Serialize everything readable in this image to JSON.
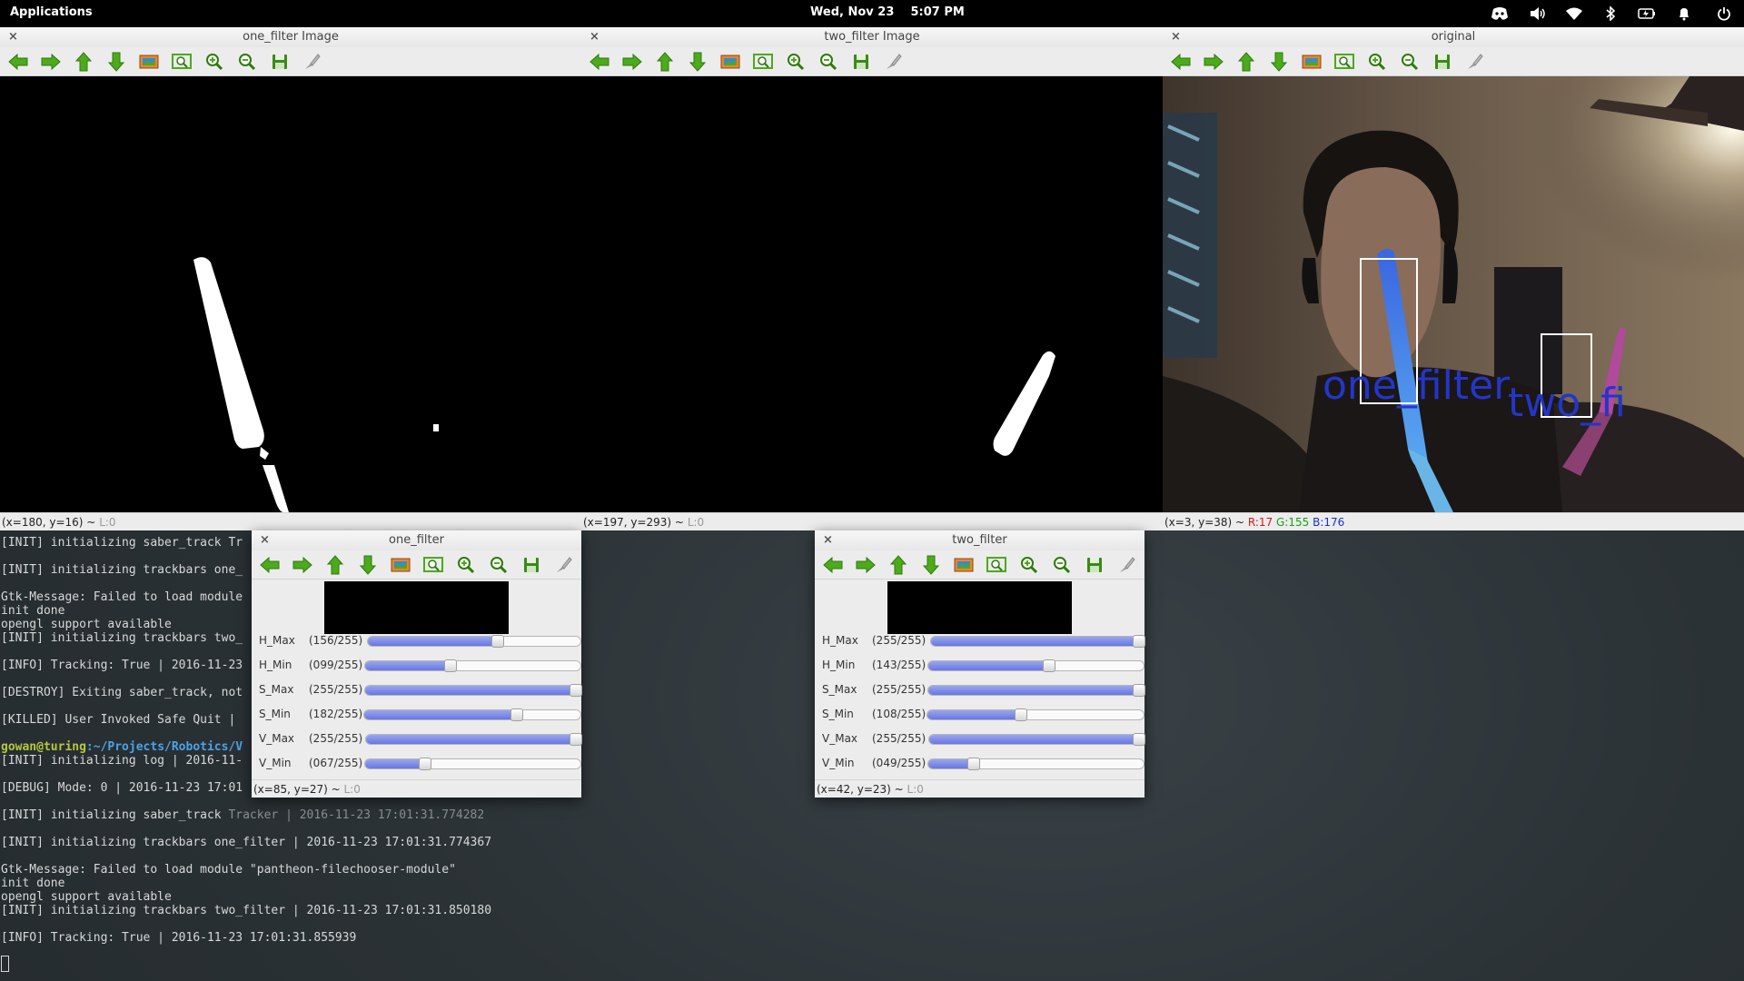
{
  "panel": {
    "apps": "Applications",
    "clock": "Wed, Nov 23    5:07 PM",
    "tray_icons": [
      "discord-icon",
      "volume-icon",
      "wifi-icon",
      "bluetooth-icon",
      "battery-icon",
      "notification-bell-icon",
      "power-icon"
    ]
  },
  "toolbar_icons": [
    "arrow-left-icon",
    "arrow-right-icon",
    "arrow-up-icon",
    "arrow-down-icon",
    "image-icon",
    "zoom-fit-icon",
    "zoom-in-icon",
    "zoom-out-icon",
    "save-icon",
    "properties-icon"
  ],
  "windows": {
    "one_filter_image": {
      "title": "one_filter Image",
      "status_coords": "(x=180, y=16) ~",
      "status_l": "L:0"
    },
    "two_filter_image": {
      "title": "two_filter Image",
      "status_coords": "(x=197, y=293) ~",
      "status_l": "L:0"
    },
    "original": {
      "title": "original",
      "status_coords": "(x=3, y=38) ~",
      "status_r": "R:17",
      "status_g": "G:155",
      "status_b": "B:176",
      "overlay_one": "one_filter",
      "overlay_two": "two_fi"
    },
    "one_filter": {
      "title": "one_filter",
      "status_coords": "(x=85, y=27) ~",
      "status_l": "L:0",
      "trackbars": [
        {
          "name": "H_Max",
          "value": "(156/255)",
          "level": 156
        },
        {
          "name": "H_Min",
          "value": "(099/255)",
          "level": 99
        },
        {
          "name": "S_Max",
          "value": "(255/255)",
          "level": 255
        },
        {
          "name": "S_Min",
          "value": "(182/255)",
          "level": 182
        },
        {
          "name": "V_Max",
          "value": "(255/255)",
          "level": 255
        },
        {
          "name": "V_Min",
          "value": "(067/255)",
          "level": 67
        }
      ]
    },
    "two_filter": {
      "title": "two_filter",
      "status_coords": "(x=42, y=23) ~",
      "status_l": "L:0",
      "trackbars": [
        {
          "name": "H_Max",
          "value": "(255/255)",
          "level": 255
        },
        {
          "name": "H_Min",
          "value": "(143/255)",
          "level": 143
        },
        {
          "name": "S_Max",
          "value": "(255/255)",
          "level": 255
        },
        {
          "name": "S_Min",
          "value": "(108/255)",
          "level": 108
        },
        {
          "name": "V_Max",
          "value": "(255/255)",
          "level": 255
        },
        {
          "name": "V_Min",
          "value": "(049/255)",
          "level": 49
        }
      ]
    }
  },
  "terminal": {
    "hidden_lines": [
      "[INIT] initializing saber_track Tr",
      "[INIT] initializing trackbars one_",
      "Gtk-Message: Failed to load module",
      "init done",
      "opengl support available",
      "[INIT] initializing trackbars two_",
      "[INFO] Tracking: True | 2016-11-23",
      "[DESTROY] Exiting saber_track, not",
      "[KILLED] User Invoked Safe Quit | ",
      "[INIT] initializing log | 2016-11-",
      "[DEBUG] Mode: 0 | 2016-11-23 17:01"
    ],
    "prompt_user": "gowan@turing",
    "prompt_path": ":~/Projects/Robotics/V",
    "saber_init": "[INIT] initializing saber_track ",
    "saber_init_rest": "Tracker | 2016-11-23 17:01:31.774282",
    "lines": [
      "[INIT] initializing trackbars one_filter | 2016-11-23 17:01:31.774367",
      "Gtk-Message: Failed to load module \"pantheon-filechooser-module\"",
      "init done",
      "opengl support available",
      "[INIT] initializing trackbars two_filter | 2016-11-23 17:01:31.850180",
      "[INFO] Tracking: True | 2016-11-23 17:01:31.855939"
    ]
  },
  "colors": {
    "accent_fill": "#6877e0",
    "box_overlay_blue": "#2535c8",
    "prompt_green": "#b6c93a",
    "prompt_blue": "#4aa3e8"
  }
}
